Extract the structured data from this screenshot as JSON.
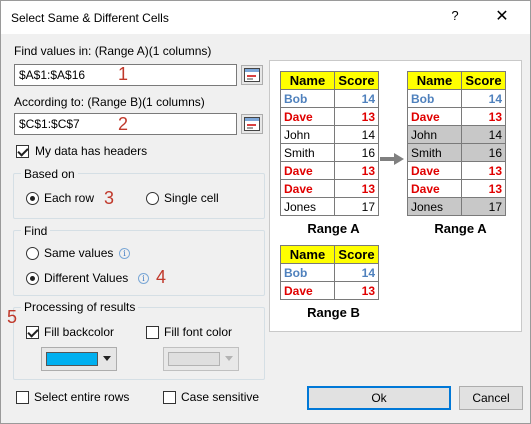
{
  "window": {
    "title": "Select Same & Different Cells",
    "help": "?",
    "close": "✕"
  },
  "find_values": {
    "label": "Find values in: (Range A)(1 columns)",
    "value": "$A$1:$A$16",
    "step": "1"
  },
  "according_to": {
    "label": "According to: (Range B)(1 columns)",
    "value": "$C$1:$C$7",
    "step": "2"
  },
  "headers_checkbox": {
    "label": "My data has headers",
    "checked": true
  },
  "based_on": {
    "title": "Based on",
    "options": [
      "Each row",
      "Single cell"
    ],
    "selected": "Each row",
    "step": "3"
  },
  "find": {
    "title": "Find",
    "options": [
      "Same values",
      "Different Values"
    ],
    "selected": "Different Values",
    "step": "4"
  },
  "processing": {
    "title": "Processing of results",
    "step": "5",
    "fill_backcolor": {
      "label": "Fill backcolor",
      "checked": true,
      "color": "#00b0f0"
    },
    "fill_fontcolor": {
      "label": "Fill font color",
      "checked": false,
      "color": "#d9d9d9"
    }
  },
  "bottom": {
    "select_rows": "Select entire rows",
    "case_sensitive": "Case sensitive",
    "ok": "Ok",
    "cancel": "Cancel"
  },
  "preview": {
    "headers": [
      "Name",
      "Score"
    ],
    "range_a": {
      "caption": "Range A",
      "rows": [
        {
          "name": "Bob",
          "score": "14",
          "color": "blue"
        },
        {
          "name": "Dave",
          "score": "13",
          "color": "red"
        },
        {
          "name": "John",
          "score": "14",
          "color": "black"
        },
        {
          "name": "Smith",
          "score": "16",
          "color": "black"
        },
        {
          "name": "Dave",
          "score": "13",
          "color": "red"
        },
        {
          "name": "Dave",
          "score": "13",
          "color": "red"
        },
        {
          "name": "Jones",
          "score": "17",
          "color": "black"
        }
      ]
    },
    "range_a_result": {
      "caption": "Range A",
      "rows": [
        {
          "name": "Bob",
          "score": "14",
          "color": "blue",
          "highlight": false
        },
        {
          "name": "Dave",
          "score": "13",
          "color": "red",
          "highlight": false
        },
        {
          "name": "John",
          "score": "14",
          "color": "black",
          "highlight": true
        },
        {
          "name": "Smith",
          "score": "16",
          "color": "black",
          "highlight": true
        },
        {
          "name": "Dave",
          "score": "13",
          "color": "red",
          "highlight": false
        },
        {
          "name": "Dave",
          "score": "13",
          "color": "red",
          "highlight": false
        },
        {
          "name": "Jones",
          "score": "17",
          "color": "black",
          "highlight": true
        }
      ]
    },
    "range_b": {
      "caption": "Range B",
      "rows": [
        {
          "name": "Bob",
          "score": "14",
          "color": "blue"
        },
        {
          "name": "Dave",
          "score": "13",
          "color": "red"
        }
      ]
    }
  }
}
